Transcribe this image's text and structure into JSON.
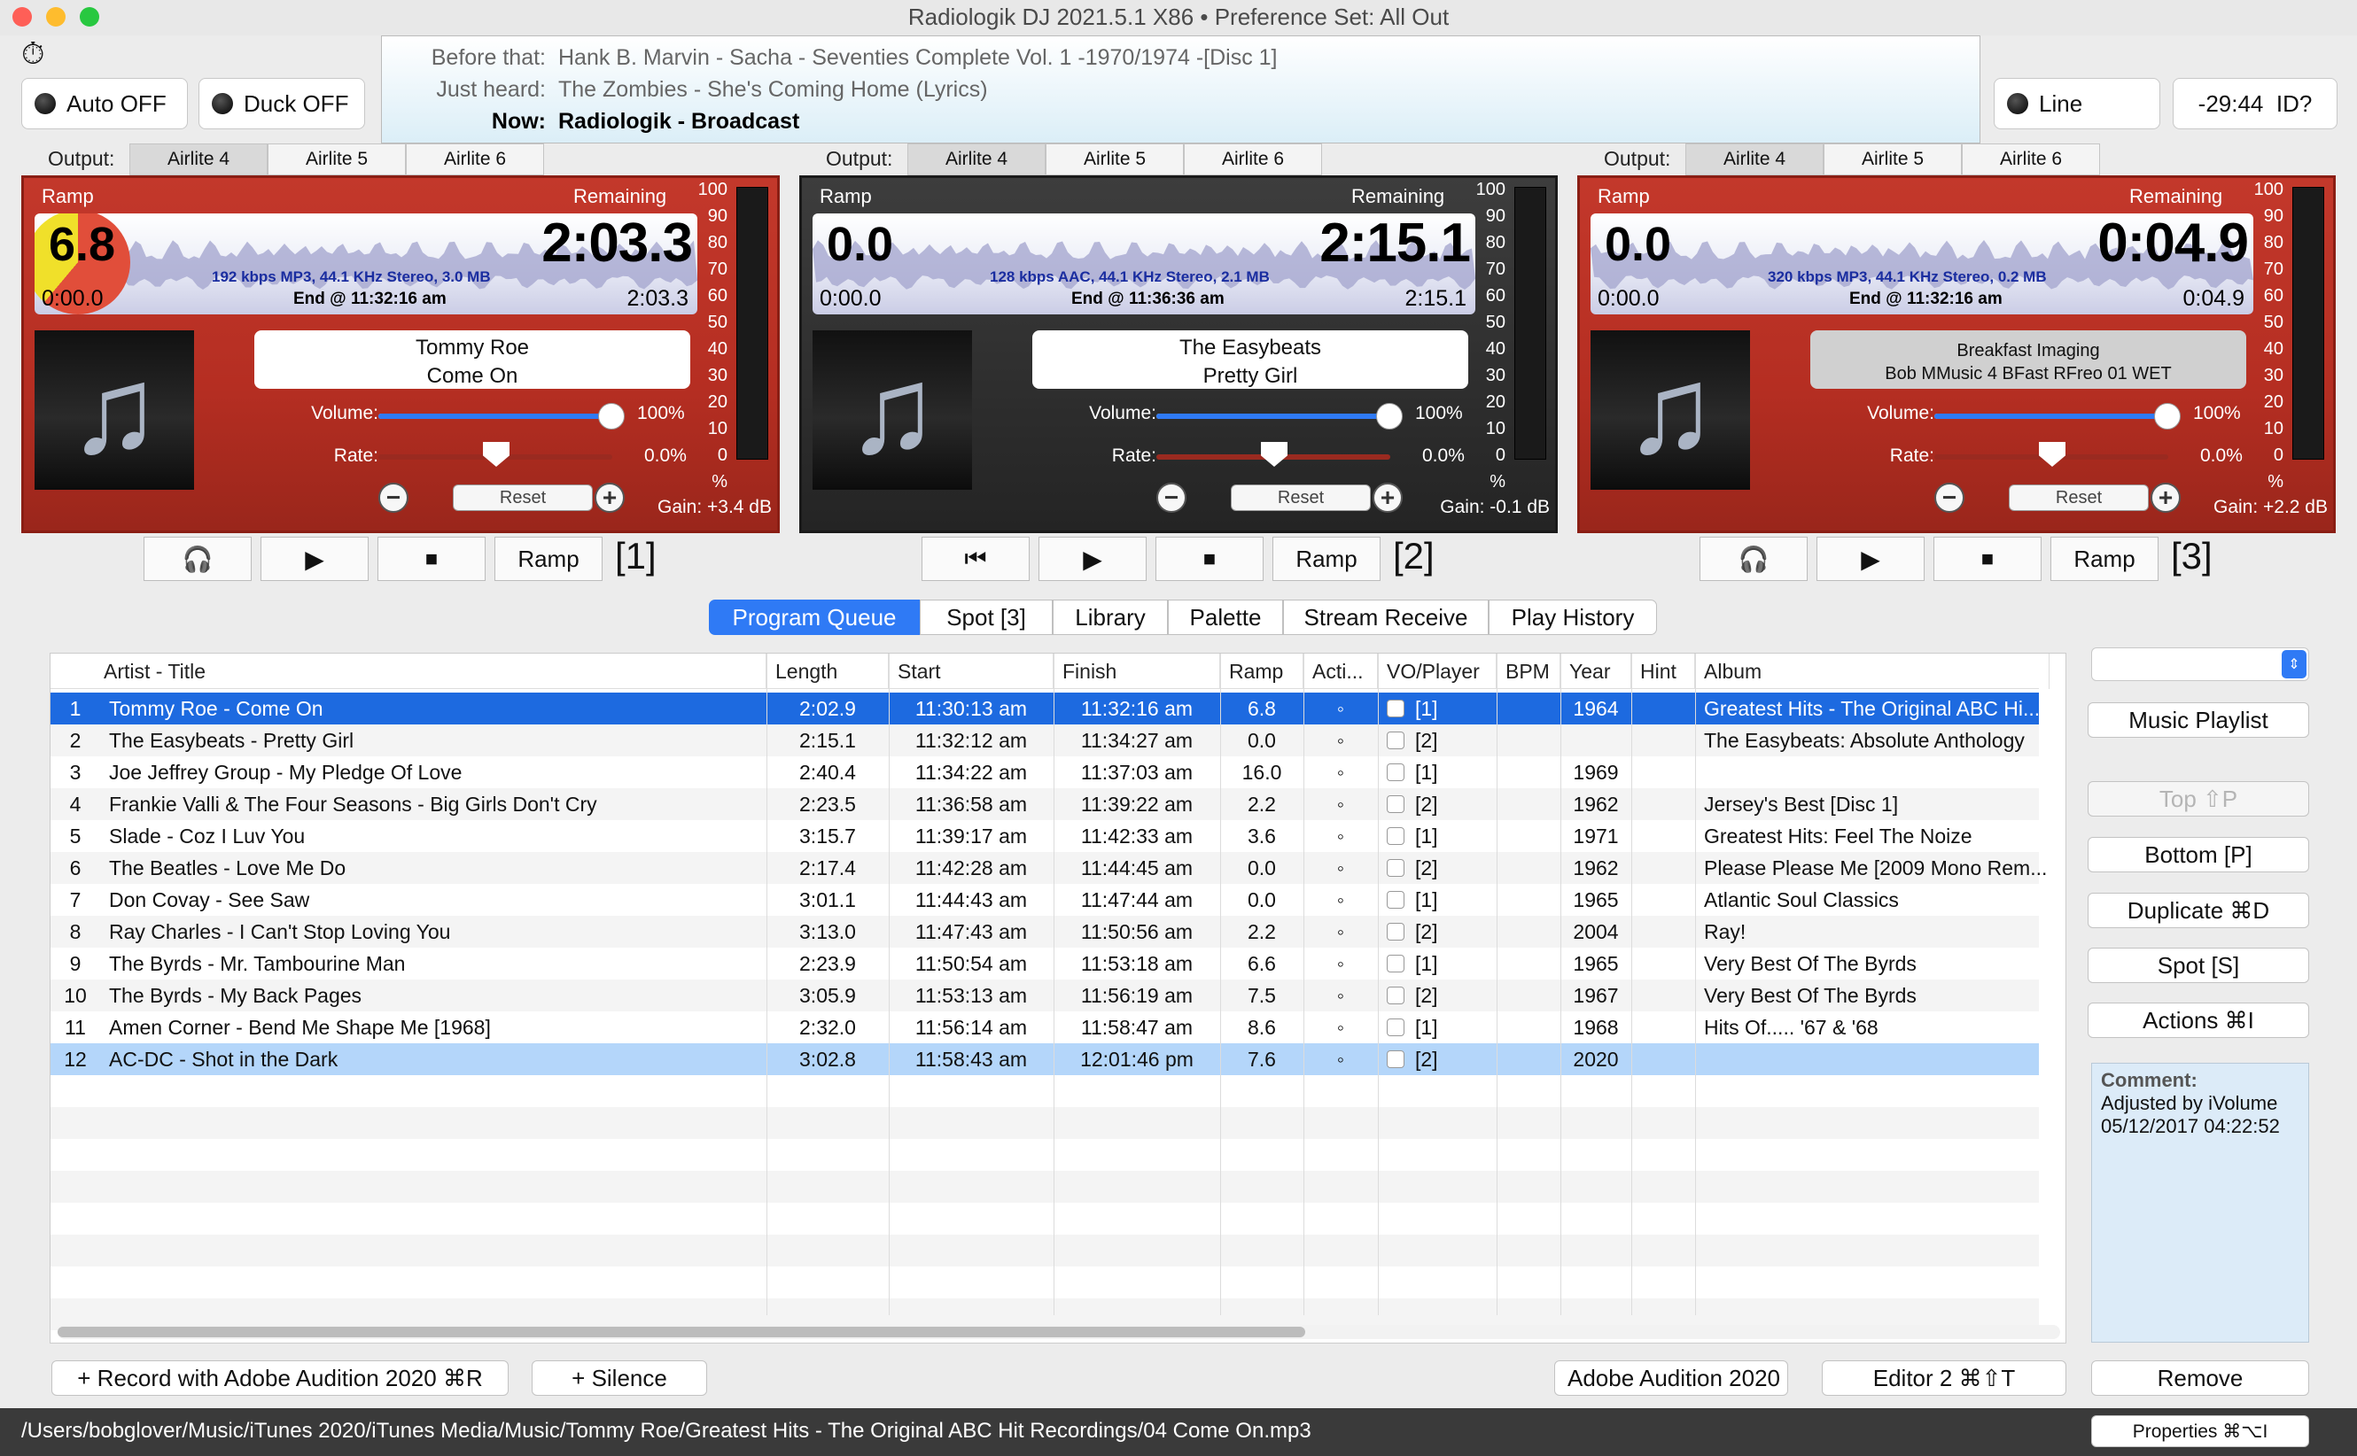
{
  "window": {
    "title": "Radiologik DJ 2021.5.1 X86   •   Preference Set: All Out"
  },
  "top_left": {
    "stopwatch_icon": "stopwatch-icon",
    "auto_label": "Auto OFF",
    "duck_label": "Duck OFF"
  },
  "history": {
    "before_label": "Before that:",
    "before_value": "Hank B. Marvin - Sacha - Seventies Complete Vol. 1 -1970/1974 -[Disc 1]",
    "heard_label": "Just heard:",
    "heard_value": "The Zombies - She's Coming Home (Lyrics)",
    "now_label": "Now:",
    "now_value": "Radiologik - Broadcast"
  },
  "top_right": {
    "line_label": "Line",
    "clock": "-29:44",
    "id_label": "ID?"
  },
  "output_label": "Output:",
  "outputs": [
    "Airlite 4",
    "Airlite 5",
    "Airlite 6"
  ],
  "decks": [
    {
      "ramp_label": "Ramp",
      "remaining_label": "Remaining",
      "ramp_value": "6.8",
      "remaining": "2:03.3",
      "elapsed": "0:00.0",
      "remaining_small": "2:03.3",
      "format": "192 kbps MP3, 44.1 KHz Stereo, 3.0 MB",
      "end_at": "End @ 11:32:16 am",
      "track_line1": "Tommy Roe",
      "track_line2": "Come On",
      "volume_label": "Volume:",
      "volume_value": "100%",
      "volume_level": 1.0,
      "rate_label": "Rate:",
      "rate_value": "0.0%",
      "reset_label": "Reset",
      "gain": "Gain: +3.4 dB",
      "transport": [
        "headphones-icon",
        "play-icon",
        "cue-icon"
      ],
      "ramp_button": "Ramp",
      "deck_number": "[1]",
      "active": true
    },
    {
      "ramp_label": "Ramp",
      "remaining_label": "Remaining",
      "ramp_value": "0.0",
      "remaining": "2:15.1",
      "elapsed": "0:00.0",
      "remaining_small": "2:15.1",
      "format": "128 kbps AAC, 44.1 KHz Stereo, 2.1 MB",
      "end_at": "End @ 11:36:36 am",
      "track_line1": "The Easybeats",
      "track_line2": "Pretty Girl",
      "volume_label": "Volume:",
      "volume_value": "100%",
      "volume_level": 1.0,
      "rate_label": "Rate:",
      "rate_value": "0.0%",
      "reset_label": "Reset",
      "gain": "Gain: -0.1 dB",
      "transport": [
        "skip-back-icon",
        "play-icon",
        "cue-icon"
      ],
      "ramp_button": "Ramp",
      "deck_number": "[2]",
      "active": false
    },
    {
      "ramp_label": "Ramp",
      "remaining_label": "Remaining",
      "ramp_value": "0.0",
      "remaining": "0:04.9",
      "elapsed": "0:00.0",
      "remaining_small": "0:04.9",
      "format": "320 kbps MP3, 44.1 KHz Stereo, 0.2 MB",
      "end_at": "End @ 11:32:16 am",
      "track_line1": "Breakfast Imaging",
      "track_line2": "Bob MMusic 4 BFast RFreo 01 WET",
      "volume_label": "Volume:",
      "volume_value": "100%",
      "volume_level": 1.0,
      "rate_label": "Rate:",
      "rate_value": "0.0%",
      "reset_label": "Reset",
      "gain": "Gain: +2.2 dB",
      "transport": [
        "headphones-icon",
        "play-icon",
        "cue-icon"
      ],
      "ramp_button": "Ramp",
      "deck_number": "[3]",
      "active": true
    }
  ],
  "meter_scale": [
    "100",
    "90",
    "80",
    "70",
    "60",
    "50",
    "40",
    "30",
    "20",
    "10",
    "0",
    "%"
  ],
  "tabs": [
    "Program Queue",
    "Spot [3]",
    "Library",
    "Palette",
    "Stream Receive",
    "Play History"
  ],
  "table": {
    "columns": [
      "Artist - Title",
      "Length",
      "Start",
      "Finish",
      "Ramp",
      "Acti...",
      "VO/Player",
      "BPM",
      "Year",
      "Hint",
      "Album"
    ],
    "rows": [
      [
        "1",
        "Tommy Roe - Come On",
        "2:02.9",
        "11:30:13 am",
        "11:32:16 am",
        "6.8",
        "◦",
        "[1]",
        "",
        "1964",
        "",
        "Greatest Hits - The Original ABC Hi..."
      ],
      [
        "2",
        "The Easybeats - Pretty Girl",
        "2:15.1",
        "11:32:12 am",
        "11:34:27 am",
        "0.0",
        "◦",
        "[2]",
        "",
        "",
        "",
        "The Easybeats: Absolute Anthology"
      ],
      [
        "3",
        "Joe Jeffrey Group - My Pledge Of Love",
        "2:40.4",
        "11:34:22 am",
        "11:37:03 am",
        "16.0",
        "◦",
        "[1]",
        "",
        "1969",
        "",
        ""
      ],
      [
        "4",
        "Frankie Valli & The Four Seasons - Big Girls Don't Cry",
        "2:23.5",
        "11:36:58 am",
        "11:39:22 am",
        "2.2",
        "◦",
        "[2]",
        "",
        "1962",
        "",
        "Jersey's Best [Disc 1]"
      ],
      [
        "5",
        "Slade - Coz I Luv You",
        "3:15.7",
        "11:39:17 am",
        "11:42:33 am",
        "3.6",
        "◦",
        "[1]",
        "",
        "1971",
        "",
        "Greatest Hits: Feel The Noize"
      ],
      [
        "6",
        "The Beatles - Love Me Do",
        "2:17.4",
        "11:42:28 am",
        "11:44:45 am",
        "0.0",
        "◦",
        "[2]",
        "",
        "1962",
        "",
        "Please Please Me [2009 Mono Rem..."
      ],
      [
        "7",
        "Don Covay - See Saw",
        "3:01.1",
        "11:44:43 am",
        "11:47:44 am",
        "0.0",
        "◦",
        "[1]",
        "",
        "1965",
        "",
        "Atlantic Soul Classics"
      ],
      [
        "8",
        "Ray Charles - I Can't Stop Loving You",
        "3:13.0",
        "11:47:43 am",
        "11:50:56 am",
        "2.2",
        "◦",
        "[2]",
        "",
        "2004",
        "",
        "Ray!"
      ],
      [
        "9",
        "The Byrds - Mr. Tambourine Man",
        "2:23.9",
        "11:50:54 am",
        "11:53:18 am",
        "6.6",
        "◦",
        "[1]",
        "",
        "1965",
        "",
        "Very Best Of The Byrds"
      ],
      [
        "10",
        "The Byrds - My Back Pages",
        "3:05.9",
        "11:53:13 am",
        "11:56:19 am",
        "7.5",
        "◦",
        "[2]",
        "",
        "1967",
        "",
        "Very Best Of The Byrds"
      ],
      [
        "11",
        "Amen Corner - Bend Me Shape Me [1968]",
        "2:32.0",
        "11:56:14 am",
        "11:58:47 am",
        "8.6",
        "◦",
        "[1]",
        "",
        "1968",
        "",
        "Hits Of..... '67 & '68"
      ],
      [
        "12",
        "AC-DC - Shot in the Dark",
        "3:02.8",
        "11:58:43 am",
        "12:01:46 pm",
        "7.6",
        "◦",
        "[2]",
        "",
        "2020",
        "",
        ""
      ]
    ]
  },
  "side": {
    "music_playlist": "Music Playlist",
    "top": "Top ⇧P",
    "bottom": "Bottom [P]",
    "duplicate": "Duplicate ⌘D",
    "spot": "Spot [S]",
    "actions": "Actions ⌘I",
    "comment_title": "Comment:",
    "comment_line1": "Adjusted by iVolume",
    "comment_line2": "05/12/2017 04:22:52",
    "remove": "Remove"
  },
  "bottom": {
    "record": "+ Record with Adobe Audition 2020 ⌘R",
    "silence": "+ Silence",
    "audition": "Adobe Audition 2020",
    "editor": "Editor 2 ⌘⇧T",
    "path": "/Users/bobglover/Music/iTunes 2020/iTunes Media/Music/Tommy Roe/Greatest Hits - The Original ABC Hit Recordings/04 Come On.mp3",
    "properties": "Properties ⌘⌥I"
  },
  "colors": {
    "accent": "#2f7af5",
    "deck_red": "#b52e22",
    "deck_dark": "#2d2d2d",
    "selection": "#1d6ae0"
  }
}
